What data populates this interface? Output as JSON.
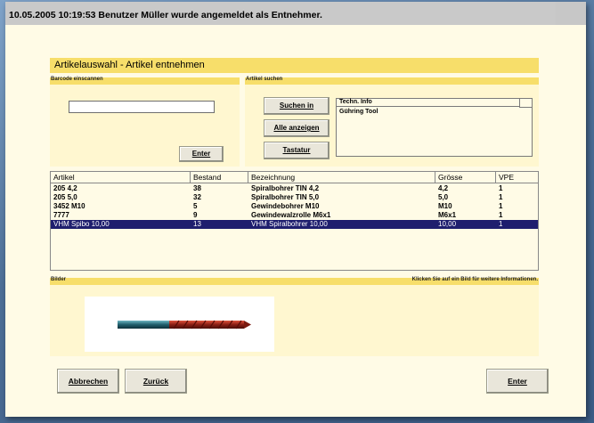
{
  "status": {
    "message": "10.05.2005 10:19:53   Benutzer Müller wurde angemeldet als Entnehmer."
  },
  "header": {
    "title": "Artikelauswahl - Artikel entnehmen"
  },
  "barcode": {
    "section_label": "Barcode einscannen",
    "input_value": "",
    "enter_label": "Enter"
  },
  "search": {
    "section_label": "Artikel suchen",
    "buttons": [
      {
        "label": "Suchen in"
      },
      {
        "label": "Alle anzeigen"
      },
      {
        "label": "Tastatur"
      }
    ],
    "techinfo": {
      "header": "Techn. Info",
      "value": "Gühring Tool"
    }
  },
  "table": {
    "columns": [
      "Artikel",
      "Bestand",
      "Bezeichnung",
      "Grösse",
      "VPE"
    ],
    "rows": [
      {
        "artikel": "205 4,2",
        "bestand": "38",
        "bezeichnung": "Spiralbohrer TIN 4,2",
        "groesse": "4,2",
        "vpe": "1"
      },
      {
        "artikel": "205 5,0",
        "bestand": "32",
        "bezeichnung": "Spiralbohrer TIN 5,0",
        "groesse": "5,0",
        "vpe": "1"
      },
      {
        "artikel": "3452 M10",
        "bestand": "5",
        "bezeichnung": "Gewindebohrer M10",
        "groesse": "M10",
        "vpe": "1"
      },
      {
        "artikel": "7777",
        "bestand": "9",
        "bezeichnung": "Gewindewalzrolle M6x1",
        "groesse": "M6x1",
        "vpe": "1"
      },
      {
        "artikel": "VHM Spibo 10,00",
        "bestand": "13",
        "bezeichnung": "VHM Spiralbohrer 10,00",
        "groesse": "10,00",
        "vpe": "1",
        "selected": true
      }
    ]
  },
  "images": {
    "section_label": "Bilder",
    "hint": "Klicken Sie auf ein Bild für weitere Informationen.",
    "image_icon": "drill-bit-icon"
  },
  "footer": {
    "cancel_label": "Abbrechen",
    "back_label": "Zurück",
    "enter_label": "Enter"
  },
  "colors": {
    "accent_yellow": "#f7de6a",
    "selection": "#1e1e6e",
    "panel": "#fff7d0"
  }
}
